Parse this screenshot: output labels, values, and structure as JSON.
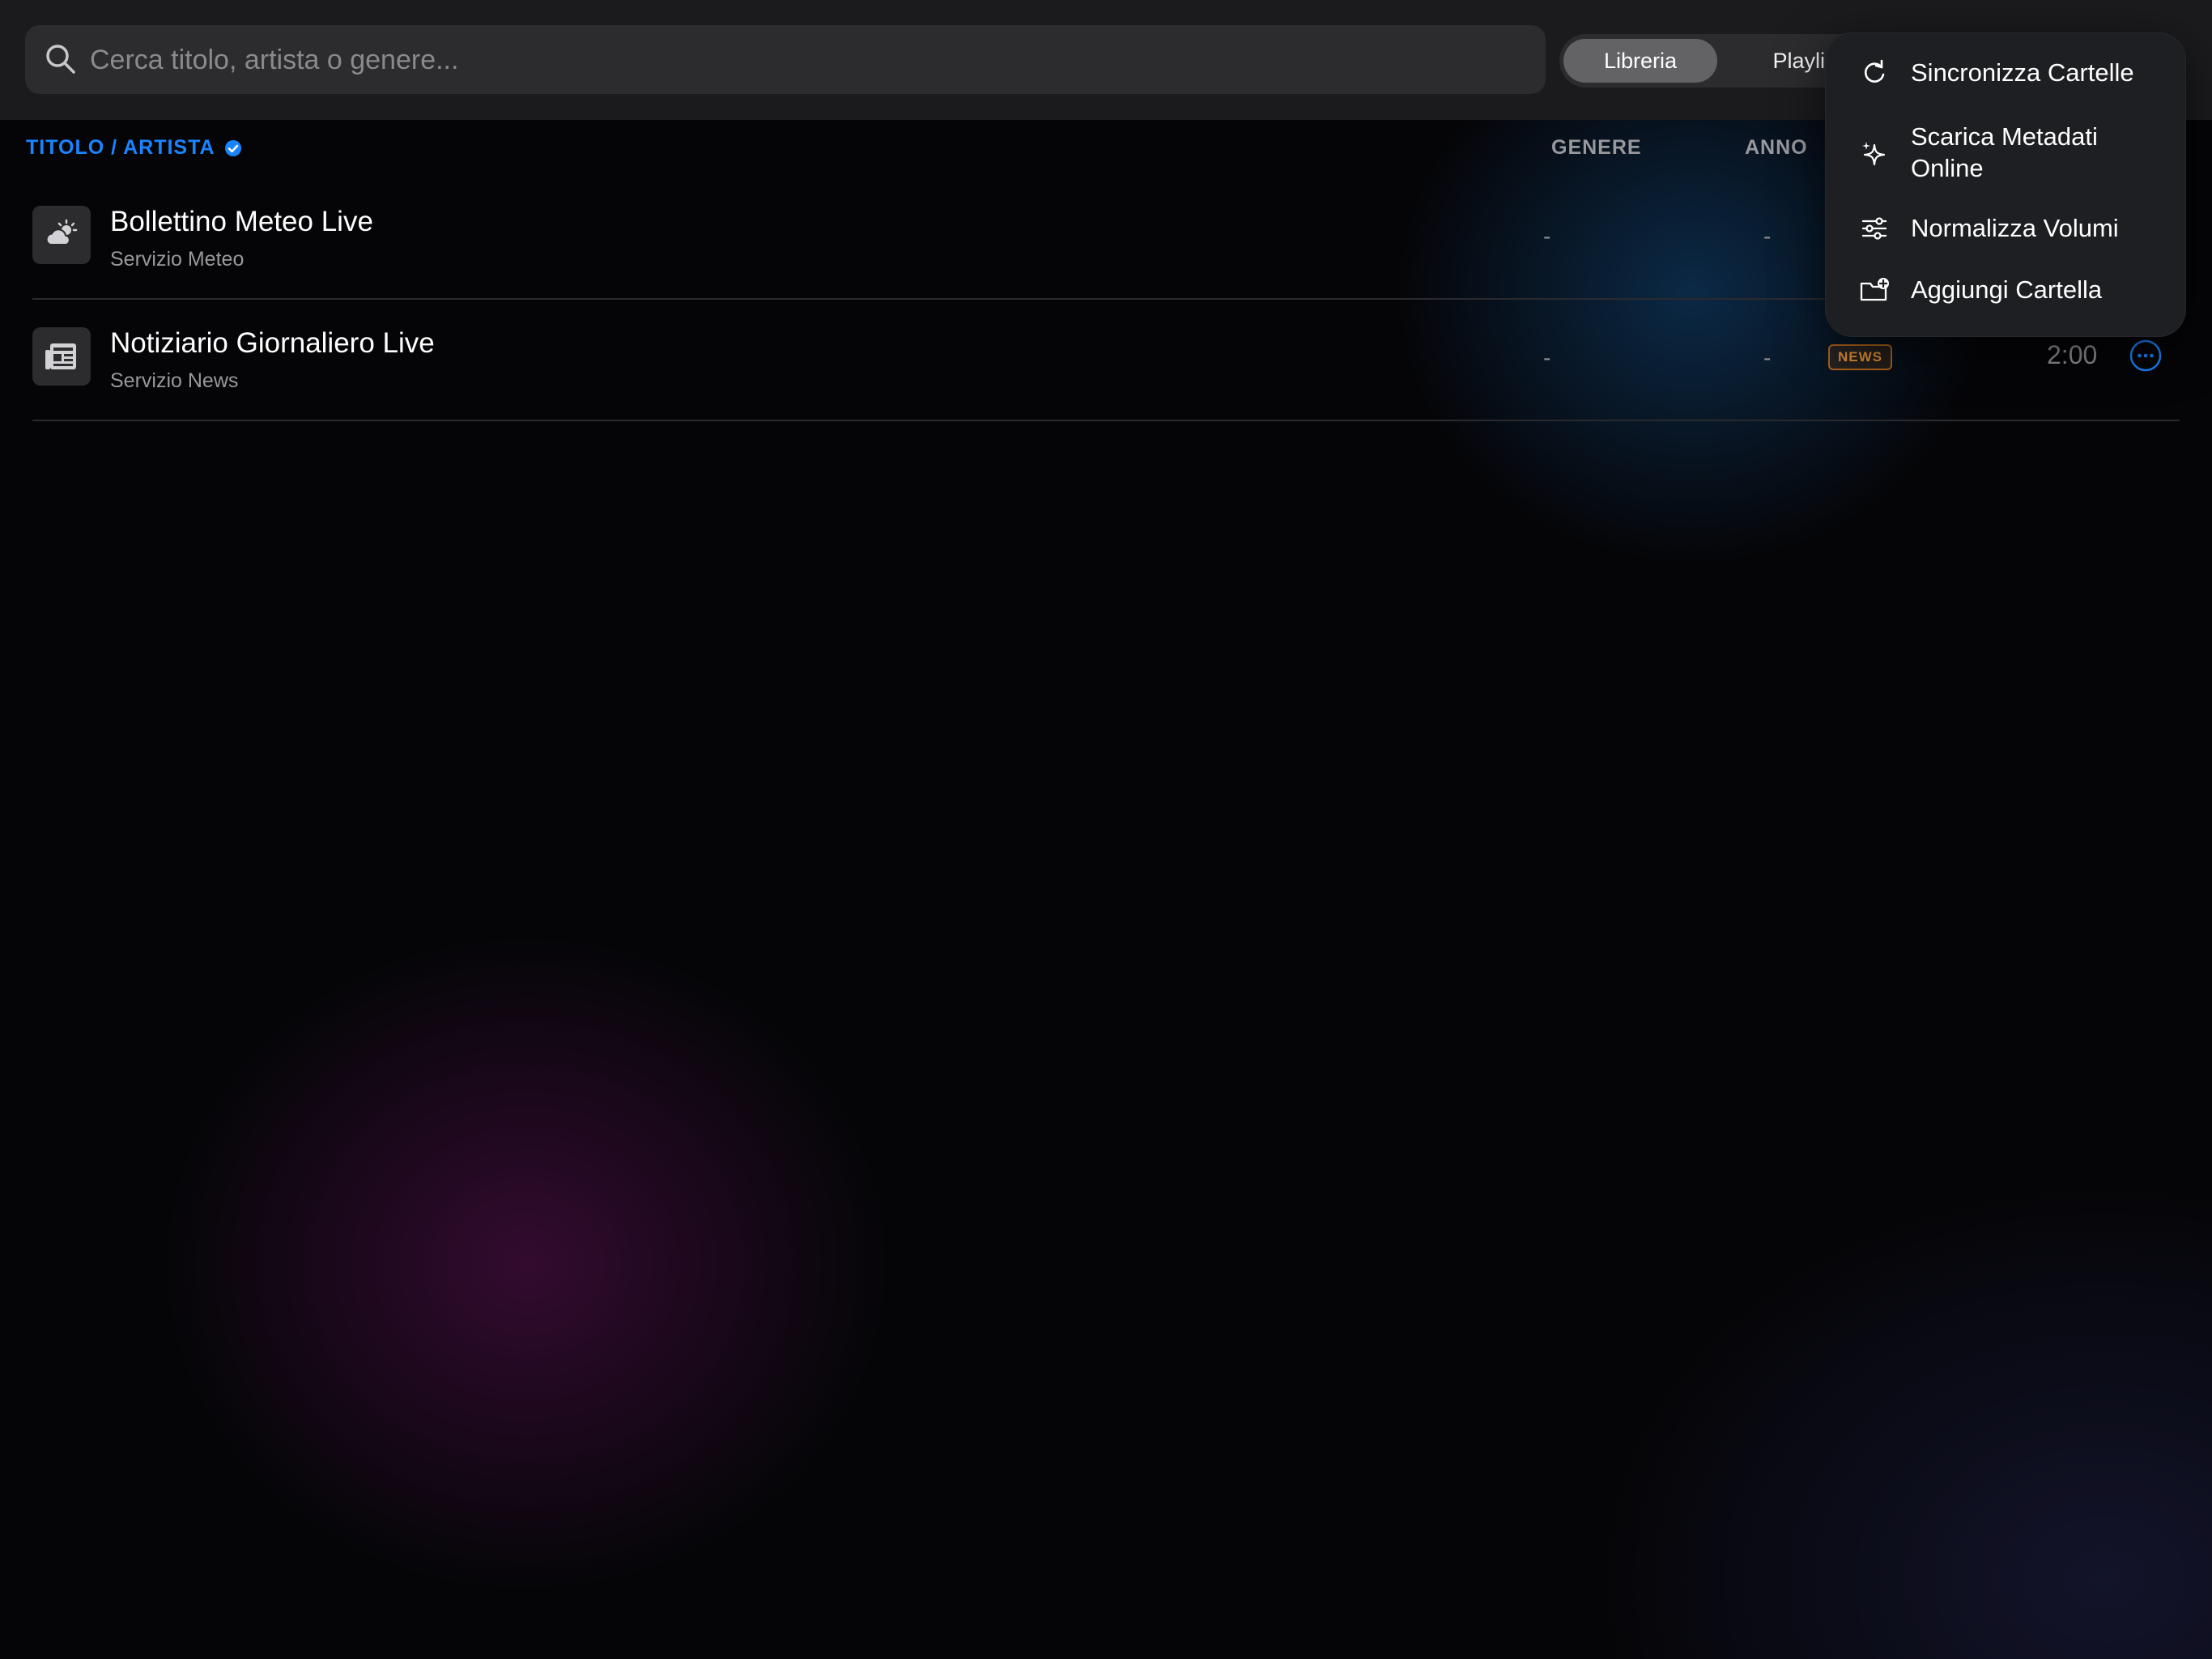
{
  "search": {
    "placeholder": "Cerca titolo, artista o genere..."
  },
  "tabs": [
    {
      "label": "Libreria",
      "active": true
    },
    {
      "label": "Playlis",
      "active": false
    }
  ],
  "columns": {
    "title": "TITOLO / ARTISTA",
    "genre": "GENERE",
    "year": "ANNO"
  },
  "rows": [
    {
      "title": "Bollettino Meteo Live",
      "subtitle": "Servizio Meteo",
      "genre": "-",
      "year": "-",
      "icon": "cloud-sun-icon"
    },
    {
      "title": "Notiziario Giornaliero Live",
      "subtitle": "Servizio News",
      "genre": "-",
      "year": "-",
      "badge": "NEWS",
      "duration": "2:00",
      "icon": "newspaper-icon"
    }
  ],
  "menu": {
    "items": [
      {
        "label": "Sincronizza Cartelle",
        "icon": "refresh-icon"
      },
      {
        "label": "Scarica Metadati Online",
        "icon": "sparkles-icon"
      },
      {
        "label": "Normalizza Volumi",
        "icon": "sliders-icon"
      },
      {
        "label": "Aggiungi Cartella",
        "icon": "folder-plus-icon"
      }
    ]
  },
  "colors": {
    "accent": "#1a84ff",
    "badge": "#e59034"
  }
}
